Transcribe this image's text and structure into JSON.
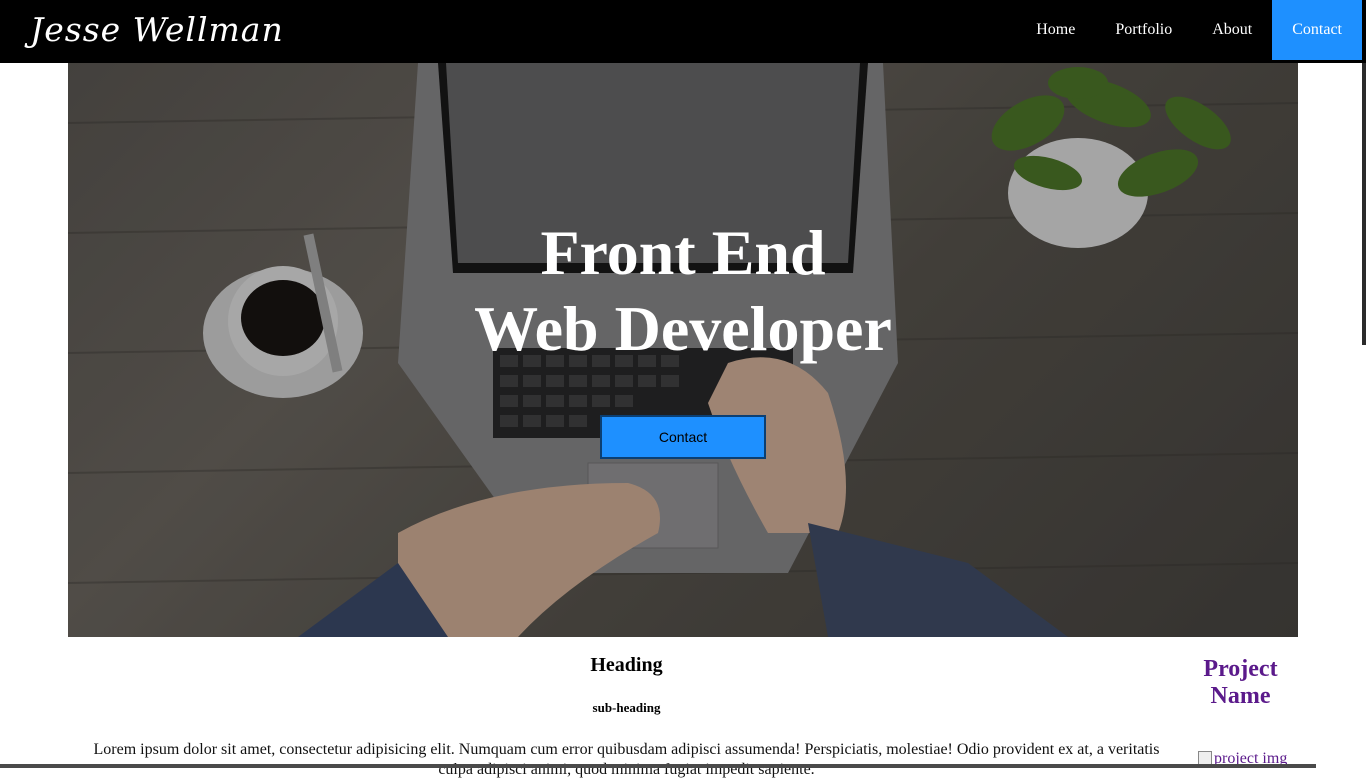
{
  "nav": {
    "brand": "Jesse Wellman",
    "links": [
      {
        "label": "Home"
      },
      {
        "label": "Portfolio"
      },
      {
        "label": "About"
      },
      {
        "label": "Contact"
      }
    ],
    "active_color": "#1e90ff"
  },
  "hero": {
    "title_line1": "Front End",
    "title_line2": "Web Developer",
    "cta_label": "Contact"
  },
  "content": {
    "heading": "Heading",
    "subheading": "sub-heading",
    "body": "Lorem ipsum dolor sit amet, consectetur adipisicing elit. Numquam cum error quibusdam adipisci assumenda! Perspiciatis, molestiae! Odio provident ex at, a veritatis culpa adipisci animi, quod minima fugiat impedit sapiente."
  },
  "project": {
    "name": "Project Name",
    "img_alt": "project img"
  }
}
